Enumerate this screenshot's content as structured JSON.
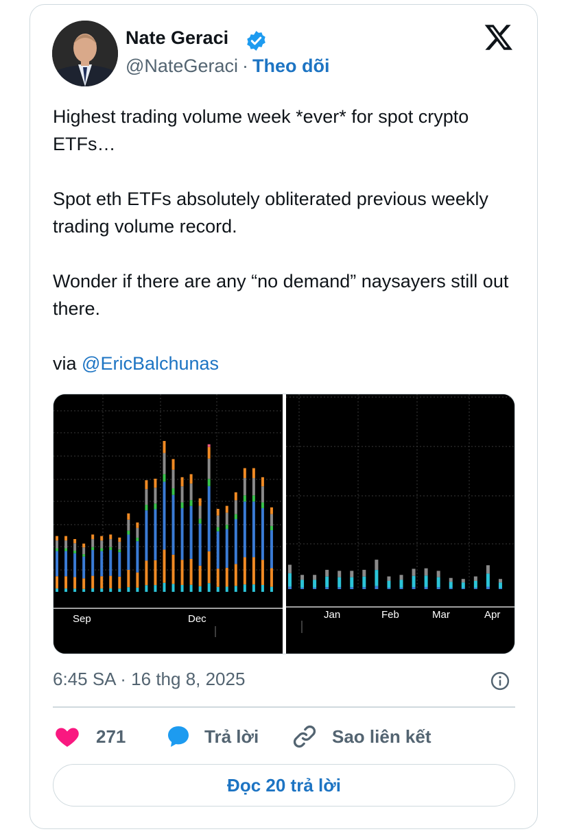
{
  "author": {
    "name": "Nate Geraci",
    "handle": "@NateGeraci",
    "separator": "·",
    "follow_label": "Theo dõi"
  },
  "tweet": {
    "paragraphs": [
      "Highest trading volume week *ever* for spot crypto ETFs…",
      "Spot eth ETFs absolutely obliterated previous weekly trading volume record.",
      "Wonder if there are any “no demand” naysayers still out there."
    ],
    "via_prefix": "via ",
    "via_mention": "@EricBalchunas"
  },
  "media": {
    "left_chart": {
      "x_labels": [
        "Sep",
        "Dec"
      ],
      "series_colors": {
        "base": "#3a7bd5",
        "mid": "#f08a24",
        "cyan": "#2bc4d8",
        "green": "#38c24b",
        "gray": "#8a8a8a",
        "pink": "#e8587a"
      },
      "bar_totals": [
        0.37,
        0.37,
        0.35,
        0.32,
        0.38,
        0.37,
        0.38,
        0.36,
        0.52,
        0.46,
        0.74,
        0.75,
        1.0,
        0.88,
        0.76,
        0.78,
        0.62,
        0.96,
        0.55,
        0.57,
        0.66,
        0.82,
        0.82,
        0.76,
        0.56
      ]
    },
    "right_chart": {
      "x_labels": [
        "Jan",
        "Feb",
        "Mar",
        "Apr"
      ],
      "bar_totals": [
        0.48,
        0.28,
        0.28,
        0.38,
        0.36,
        0.36,
        0.38,
        0.58,
        0.25,
        0.28,
        0.4,
        0.41,
        0.36,
        0.22,
        0.2,
        0.25,
        0.47,
        0.2
      ]
    }
  },
  "footer": {
    "timestamp": "6:45 SA · 16 thg 8, 2025"
  },
  "actions": {
    "like_count": "271",
    "reply_label": "Trả lời",
    "copy_link_label": "Sao liên kết"
  },
  "read_replies_label": "Đọc 20 trả lời",
  "colors": {
    "accent": "#1d74c3",
    "heart": "#f91880",
    "muted": "#536471"
  }
}
